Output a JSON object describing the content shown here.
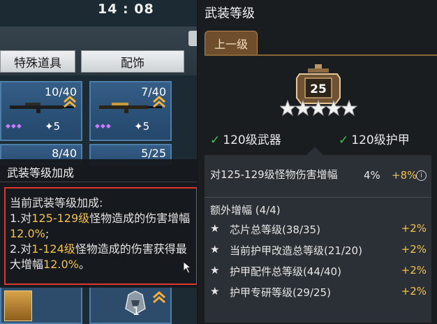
{
  "status_bar": {
    "time": "14 : 08"
  },
  "inventory": {
    "tabs": [
      "特殊道具",
      "配饰"
    ],
    "cards": [
      {
        "count": "10/40",
        "level": "5",
        "stars": "◆◆◆"
      },
      {
        "count": "7/40",
        "level": "5",
        "stars": "◆◆◆"
      }
    ],
    "cards_row2": [
      {
        "count": "8/40"
      },
      {
        "count": "5/25"
      }
    ],
    "bottom_cards": [
      {
        "count": ""
      },
      {
        "count": "1"
      }
    ]
  },
  "tooltip": {
    "title": "武装等级加成",
    "heading": "当前武装等级加成:",
    "line1_prefix": "1.对",
    "line1_range": "125-129级",
    "line1_mid": "怪物造成的伤害增幅",
    "line1_value": "12.0%",
    "line1_end": ";",
    "line2_prefix": "2.对",
    "line2_range": "1-124级",
    "line2_mid": "怪物造成的伤害获得最大增幅",
    "line2_value": "12.0%",
    "line2_end": "。"
  },
  "armament_panel": {
    "title": "武装等级",
    "prev_tab": "上一级",
    "level": "25",
    "star_count": 5,
    "req_weapon": "120级武器",
    "req_armor": "120级护甲",
    "damage_label": "对125-129级怪物伤害增幅",
    "damage_current": "4%",
    "damage_bonus": "+8%",
    "info_icon": "i",
    "extra_title": "额外增幅 (4/4)",
    "extras": [
      {
        "label": "芯片总等级(38/35)",
        "value": "+2%"
      },
      {
        "label": "当前护甲改造总等级(21/20)",
        "value": "+2%"
      },
      {
        "label": "护甲配件总等级(44/40)",
        "value": "+2%"
      },
      {
        "label": "护甲专研等级(29/25)",
        "value": "+2%"
      }
    ]
  },
  "colors": {
    "accent_gold": "#f2c14e",
    "highlight_red": "#e2352e",
    "check_green": "#3fc35a"
  }
}
